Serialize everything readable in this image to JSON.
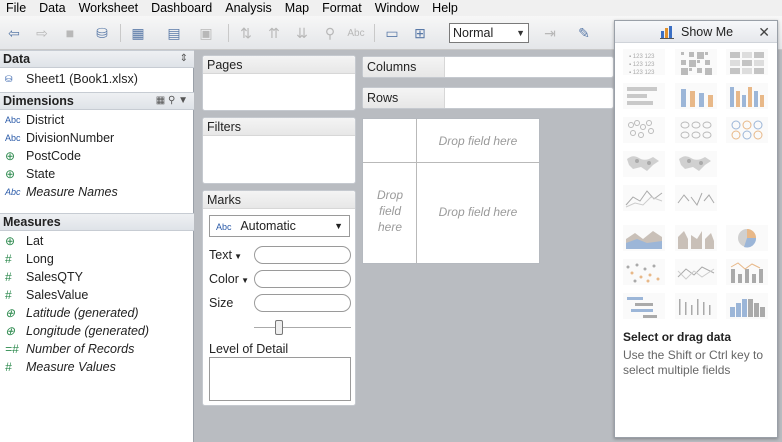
{
  "menu": [
    "File",
    "Data",
    "Worksheet",
    "Dashboard",
    "Analysis",
    "Map",
    "Format",
    "Window",
    "Help"
  ],
  "toolbar": {
    "mark_size_value": "Normal",
    "icons": [
      "back-icon",
      "forward-icon",
      "save-icon",
      "connect-data-icon",
      "new-worksheet-icon",
      "new-dashboard-icon",
      "duplicate-icon",
      "clear-icon",
      "swap-icon",
      "sort-asc-icon",
      "sort-desc-icon",
      "group-icon",
      "label-icon",
      "presentation-icon",
      "fit-icon",
      "fix-axes-icon",
      "highlight-icon"
    ]
  },
  "data_pane": {
    "title": "Data",
    "source": "Sheet1 (Book1.xlsx)",
    "dimensions_title": "Dimensions",
    "dimensions": [
      {
        "type": "Abc",
        "name": "District"
      },
      {
        "type": "Abc",
        "name": "DivisionNumber"
      },
      {
        "type": "geo",
        "name": "PostCode"
      },
      {
        "type": "geo",
        "name": "State"
      },
      {
        "type": "Abc",
        "name": "Measure Names"
      }
    ],
    "measures_title": "Measures",
    "measures": [
      {
        "type": "geo",
        "name": "Lat"
      },
      {
        "type": "#",
        "name": "Long"
      },
      {
        "type": "#",
        "name": "SalesQTY"
      },
      {
        "type": "#",
        "name": "SalesValue"
      },
      {
        "type": "geo",
        "name": "Latitude (generated)"
      },
      {
        "type": "geo",
        "name": "Longitude (generated)"
      },
      {
        "type": "=#",
        "name": "Number of Records"
      },
      {
        "type": "#",
        "name": "Measure Values"
      }
    ]
  },
  "shelves": {
    "pages": "Pages",
    "filters": "Filters",
    "marks": "Marks",
    "mark_type_prefix": "Abc",
    "mark_type": "Automatic",
    "text": "Text",
    "color": "Color",
    "size": "Size",
    "level_of_detail": "Level of Detail",
    "columns": "Columns",
    "rows": "Rows"
  },
  "canvas": {
    "drop_top": "Drop field here",
    "drop_left": "Drop field here",
    "drop_center": "Drop field here"
  },
  "show_me": {
    "title": "Show Me",
    "close": "✕",
    "select_title": "Select or drag data",
    "hint": "Use the Shift or Ctrl key to select multiple fields",
    "chart_types": [
      "text-table",
      "heat-map",
      "highlight-table",
      "horizontal-bars",
      "stacked-bars",
      "side-by-side-bars",
      "circle-view",
      "side-by-side-circles",
      "packed-circles",
      "symbol-map",
      "filled-map",
      "lines-continuous",
      "lines-discrete",
      "area-continuous",
      "area-discrete",
      "pie",
      "scatter",
      "dual-lines",
      "dual-combination",
      "gantt",
      "histogram-side",
      "histogram"
    ]
  },
  "colors": {
    "accent": "#2a5aa8",
    "geo": "#2d8a4e",
    "workspace": "#b9bcc1"
  }
}
